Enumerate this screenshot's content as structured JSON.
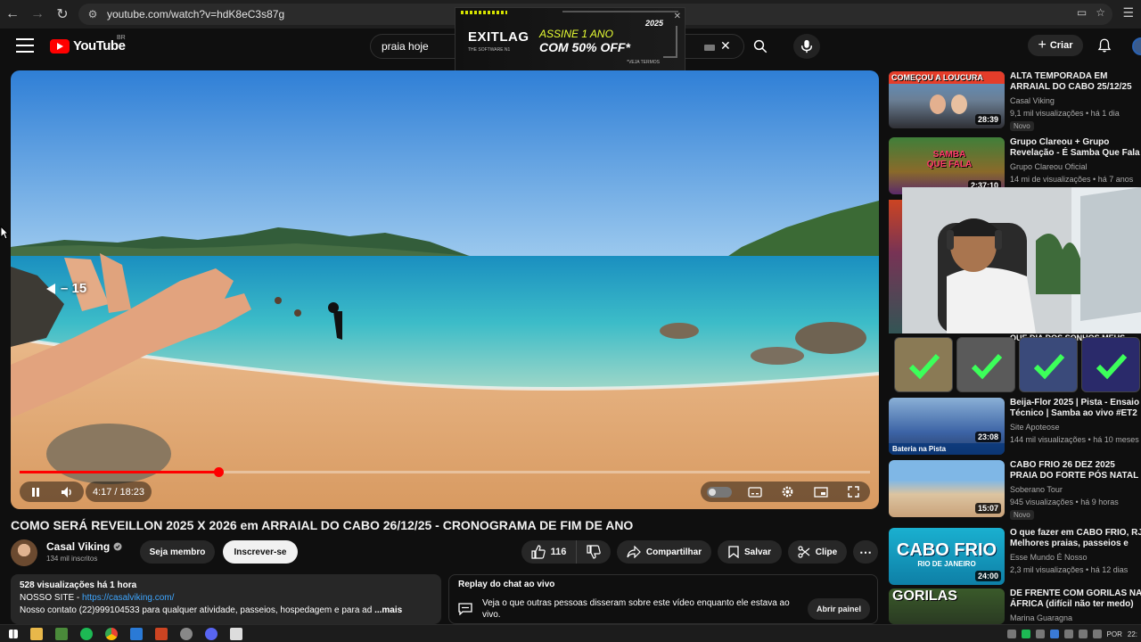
{
  "browser": {
    "url": "youtube.com/watch?v=hdK8eC3s87g"
  },
  "ad": {
    "brand": "EXITLAG",
    "tagline": "THE SOFTWARE N1",
    "line1": "ASSINE 1 ANO",
    "line2": "COM 50% OFF*",
    "year_badge": "2025",
    "terms": "*VEJA TERMOS"
  },
  "header": {
    "logo_text": "YouTube",
    "country": "BR",
    "search_query": "praia hoje",
    "create_label": "Criar"
  },
  "player": {
    "seek_indicator": "– 15",
    "time_display": "4:17 / 18:23",
    "progress_fraction": 0.2335
  },
  "video": {
    "title": "COMO SERÁ REVEILLON 2025 X 2026 em ARRAIAL DO CABO 26/12/25 - CRONOGRAMA DE FIM DE ANO",
    "channel_name": "Casal Viking",
    "subscribers": "134 mil inscritos",
    "member_label": "Seja membro",
    "subscribe_label": "Inscrever-se",
    "likes": "116",
    "share_label": "Compartilhar",
    "save_label": "Salvar",
    "clip_label": "Clipe"
  },
  "description": {
    "meta": "528 visualizações  há 1 hora",
    "site_prefix": "NOSSO SITE - ",
    "site_link": "https://casalviking.com/",
    "contact": "Nosso contato (22)999104533 para qualquer atividade, passeios, hospedagem e para ad",
    "more": "...mais"
  },
  "chat_replay": {
    "title": "Replay do chat ao vivo",
    "desc": "Veja o que outras pessoas disseram sobre este vídeo enquanto ele estava ao vivo.",
    "button": "Abrir painel"
  },
  "sidebar": {
    "items": [
      {
        "title": "ALTA TEMPORADA EM ARRAIAL DO CABO 25/12/25",
        "channel": "Casal Viking",
        "stats": "9,1 mil visualizações • há 1 dia",
        "duration": "28:39",
        "badge": "Novo",
        "thumb_caption": "COMEÇOU A LOUCURA"
      },
      {
        "title": "Grupo Clareou + Grupo Revelação - É Samba Que Fala",
        "channel": "Grupo Clareou Oficial",
        "stats": "14 mi de visualizações • há 7 anos",
        "duration": "",
        "badge": "",
        "thumb_caption": ""
      },
      {
        "title": "QUE DIA DOS SONHOS MEUS",
        "channel": "",
        "stats": "",
        "duration": "",
        "badge": "",
        "thumb_caption": ""
      },
      {
        "title": "Beija-Flor 2025 | Pista - Ensaio Técnico | Samba ao vivo #ET2",
        "channel": "Site Apoteose",
        "stats": "144 mil visualizações • há 10 meses",
        "duration": "23:08",
        "badge": "",
        "thumb_caption": "Bateria na Pista"
      },
      {
        "title": "CABO FRIO 26 DEZ 2025 PRAIA DO FORTE  PÓS NATAL",
        "channel": "Soberano Tour",
        "stats": "945 visualizações • há 9 horas",
        "duration": "15:07",
        "badge": "Novo",
        "thumb_caption": ""
      },
      {
        "title": "O que fazer em CABO FRIO, RJ Melhores praias, passeios e",
        "channel": "Esse Mundo É Nosso",
        "stats": "2,3 mil visualizações • há 12 dias",
        "duration": "24:00",
        "badge": "",
        "thumb_caption": "CABO FRIO"
      },
      {
        "title": "DE FRENTE COM GORILAS NA ÁFRICA (difícil não ter medo)",
        "channel": "Marina Guaragna",
        "stats": "",
        "duration": "",
        "badge": "",
        "thumb_caption": "GORILAS"
      }
    ],
    "samba_text": "SAMBA QUE FALA",
    "cabo_frio_sub": "RIO DE JANEIRO",
    "partial_duration": "2:37:10"
  },
  "taskbar": {
    "lang": "POR",
    "time": "22:"
  },
  "colors": {
    "accent_red": "#ff0000",
    "link_blue": "#3ea6ff",
    "bg": "#0f0f0f",
    "surface": "#272727"
  }
}
